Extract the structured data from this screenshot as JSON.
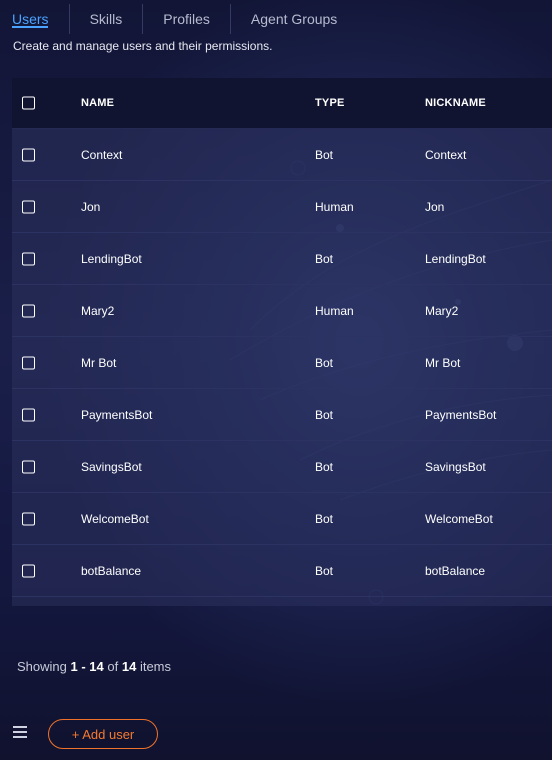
{
  "tabs": [
    {
      "label": "Users",
      "active": true
    },
    {
      "label": "Skills",
      "active": false
    },
    {
      "label": "Profiles",
      "active": false
    },
    {
      "label": "Agent Groups",
      "active": false
    }
  ],
  "subtitle": "Create and manage users and their permissions.",
  "table": {
    "columns": {
      "name": "NAME",
      "type": "TYPE",
      "nickname": "NICKNAME"
    },
    "rows": [
      {
        "name": "Context",
        "type": "Bot",
        "nickname": "Context"
      },
      {
        "name": "Jon",
        "type": "Human",
        "nickname": "Jon"
      },
      {
        "name": "LendingBot",
        "type": "Bot",
        "nickname": "LendingBot"
      },
      {
        "name": "Mary2",
        "type": "Human",
        "nickname": "Mary2"
      },
      {
        "name": "Mr Bot",
        "type": "Bot",
        "nickname": "Mr Bot"
      },
      {
        "name": "PaymentsBot",
        "type": "Bot",
        "nickname": "PaymentsBot"
      },
      {
        "name": "SavingsBot",
        "type": "Bot",
        "nickname": "SavingsBot"
      },
      {
        "name": "WelcomeBot",
        "type": "Bot",
        "nickname": "WelcomeBot"
      },
      {
        "name": "botBalance",
        "type": "Bot",
        "nickname": "botBalance"
      }
    ]
  },
  "pagination": {
    "prefix": "Showing",
    "range": "1 - 14",
    "of": "of",
    "total": "14",
    "suffix": "items"
  },
  "footer": {
    "menu_icon": "hamburger-menu-icon",
    "add_user_label": "+ Add user"
  },
  "colors": {
    "accent_tab": "#4aa3ff",
    "add_button": "#f0722a",
    "header_bg": "#111431"
  }
}
